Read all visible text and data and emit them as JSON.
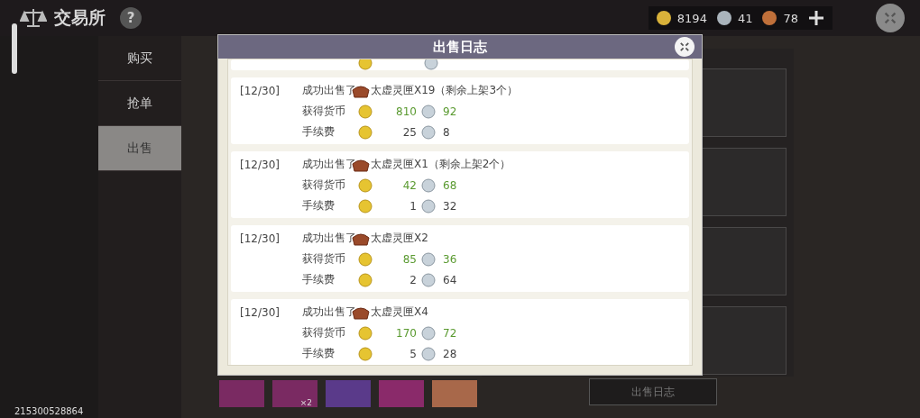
{
  "header": {
    "title": "交易所",
    "help": "?"
  },
  "currency": [
    {
      "kind": "gold",
      "amount": "8194"
    },
    {
      "kind": "silver",
      "amount": "41"
    },
    {
      "kind": "copper",
      "amount": "78"
    }
  ],
  "nav": [
    {
      "label": "购买",
      "selected": false
    },
    {
      "label": "抢单",
      "selected": false
    },
    {
      "label": "出售",
      "selected": true
    }
  ],
  "item_slots": [
    {
      "color": "#7a2a62"
    },
    {
      "color": "#7a2a62",
      "badge": "×2"
    },
    {
      "color": "#5a3a8a"
    },
    {
      "color": "#8a2a6a"
    },
    {
      "color": "#a8684a"
    }
  ],
  "background_button": "出售日志",
  "user_id": "215300528864",
  "dialog": {
    "title": "出售日志",
    "entries": [
      {
        "date": "[12/30]",
        "action": "成功出售了",
        "item": "太虚灵匣X19（剩余上架3个）",
        "earned_label": "获得货币",
        "earned_gold": "810",
        "earned_silver": "92",
        "fee_label": "手续费",
        "fee_gold": "25",
        "fee_silver": "8"
      },
      {
        "date": "[12/30]",
        "action": "成功出售了",
        "item": "太虚灵匣X1（剩余上架2个）",
        "earned_label": "获得货币",
        "earned_gold": "42",
        "earned_silver": "68",
        "fee_label": "手续费",
        "fee_gold": "1",
        "fee_silver": "32"
      },
      {
        "date": "[12/30]",
        "action": "成功出售了",
        "item": "太虚灵匣X2",
        "earned_label": "获得货币",
        "earned_gold": "85",
        "earned_silver": "36",
        "fee_label": "手续费",
        "fee_gold": "2",
        "fee_silver": "64"
      },
      {
        "date": "[12/30]",
        "action": "成功出售了",
        "item": "太虚灵匣X4",
        "earned_label": "获得货币",
        "earned_gold": "170",
        "earned_silver": "72",
        "fee_label": "手续费",
        "fee_gold": "5",
        "fee_silver": "28"
      }
    ]
  }
}
